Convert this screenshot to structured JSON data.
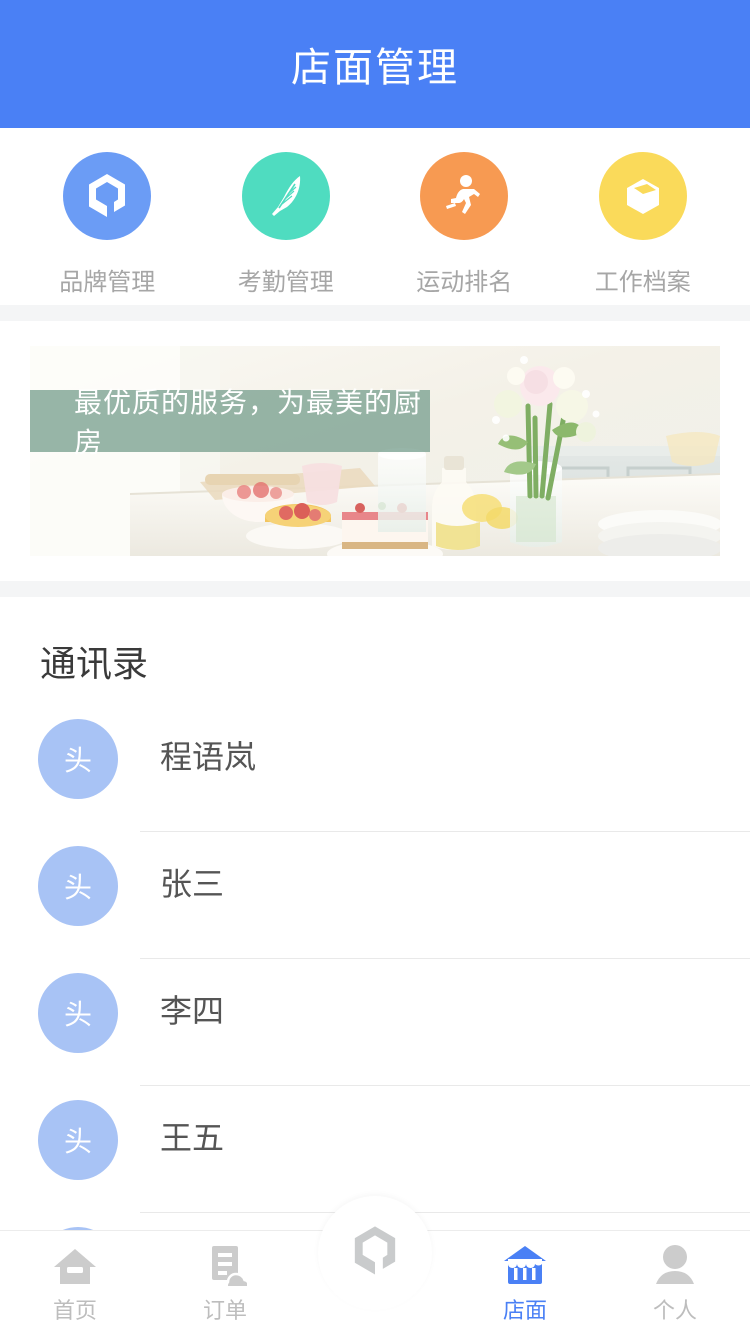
{
  "header": {
    "title": "店面管理"
  },
  "quick_actions": {
    "items": [
      {
        "label": "品牌管理",
        "icon": "hexagon-logo-icon",
        "color": "#6b9cf5"
      },
      {
        "label": "考勤管理",
        "icon": "feather-icon",
        "color": "#4fdcc0"
      },
      {
        "label": "运动排名",
        "icon": "running-person-icon",
        "color": "#f79a52"
      },
      {
        "label": "工作档案",
        "icon": "package-box-icon",
        "color": "#fada5a"
      }
    ]
  },
  "banner": {
    "caption": "最优质的服务，为最美的厨房",
    "overlay_color": "#7da392"
  },
  "contacts": {
    "title": "通讯录",
    "avatar_text": "头",
    "avatar_color": "#a8c3f5",
    "items": [
      {
        "name": "程语岚"
      },
      {
        "name": "张三"
      },
      {
        "name": "李四"
      },
      {
        "name": "王五"
      },
      {
        "name": ""
      }
    ]
  },
  "tabbar": {
    "active_color": "#4a80f5",
    "inactive_color": "#bdbdbd",
    "items": [
      {
        "label": "首页",
        "icon": "home-icon",
        "active": false
      },
      {
        "label": "订单",
        "icon": "order-cloud-icon",
        "active": false
      },
      {
        "label": "店面",
        "icon": "storefront-icon",
        "active": true
      },
      {
        "label": "个人",
        "icon": "person-icon",
        "active": false
      }
    ],
    "fab": {
      "icon": "hexagon-logo-icon"
    }
  }
}
